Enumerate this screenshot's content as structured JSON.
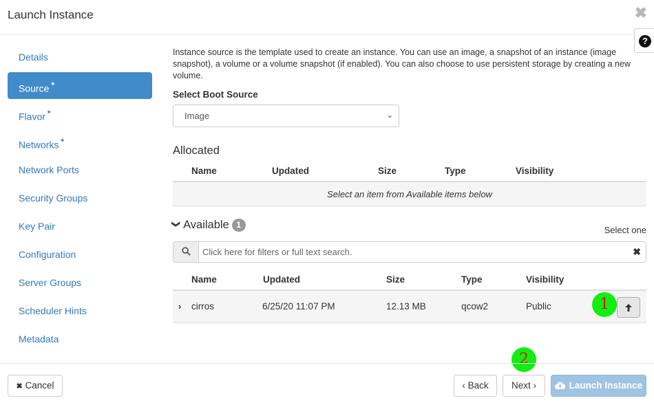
{
  "header": {
    "title": "Launch Instance",
    "close_glyph": "✖",
    "help_glyph": "?"
  },
  "nav": {
    "items": [
      {
        "label": "Details",
        "required": ""
      },
      {
        "label": "Source",
        "required": "*"
      },
      {
        "label": "Flavor",
        "required": "*"
      },
      {
        "label": "Networks",
        "required": "*"
      },
      {
        "label": "Network Ports",
        "required": ""
      },
      {
        "label": "Security Groups",
        "required": ""
      },
      {
        "label": "Key Pair",
        "required": ""
      },
      {
        "label": "Configuration",
        "required": ""
      },
      {
        "label": "Server Groups",
        "required": ""
      },
      {
        "label": "Scheduler Hints",
        "required": ""
      },
      {
        "label": "Metadata",
        "required": ""
      }
    ],
    "active": "Source"
  },
  "source": {
    "help_text": "Instance source is the template used to create an instance. You can use an image, a snapshot of an instance (image snapshot), a volume or a volume snapshot (if enabled). You can also choose to use persistent storage by creating a new volume.",
    "boot_source_label": "Select Boot Source",
    "boot_source_value": "Image",
    "boot_source_chevron": "⌄"
  },
  "columns": [
    "Name",
    "Updated",
    "Size",
    "Type",
    "Visibility"
  ],
  "allocated": {
    "title": "Allocated",
    "empty_text": "Select an item from Available items below"
  },
  "available": {
    "chevron": "❯",
    "title": "Available",
    "count": "1",
    "select_hint": "Select one",
    "search_placeholder": "Click here for filters or full text search.",
    "clear_glyph": "✖",
    "rows": [
      {
        "expand": "›",
        "name": "cirros",
        "updated": "6/25/20 11:07 PM",
        "size": "12.13 MB",
        "type": "qcow2",
        "visibility": "Public",
        "action_glyph": "🡑"
      }
    ]
  },
  "annotations": {
    "step1": "1",
    "step2": "2",
    "circle_color": "#11ee11",
    "numeral_color": "#d21a1a"
  },
  "footer": {
    "cancel_label": "Cancel",
    "cancel_glyph": "✖",
    "back_label": "Back",
    "back_glyph": "‹",
    "next_label": "Next",
    "next_glyph": "›",
    "launch_label": "Launch Instance"
  },
  "colors": {
    "accent": "#428bca",
    "link": "#337ab7",
    "launch_disabled": "#9fc3e3"
  }
}
